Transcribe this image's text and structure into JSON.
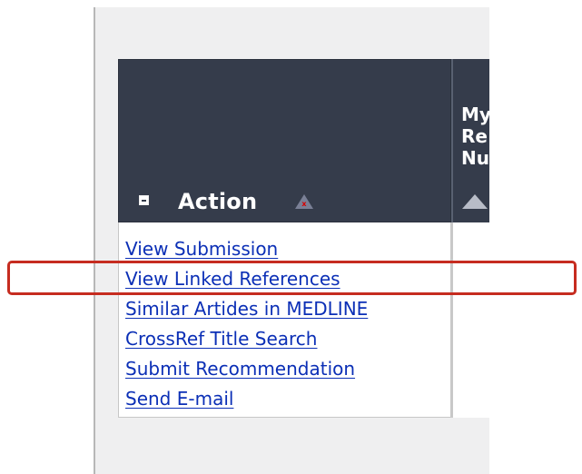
{
  "table": {
    "action_header": "Action",
    "mine_header_lines": [
      "My",
      "Re",
      "Nu"
    ]
  },
  "actions": [
    {
      "label": "View Submission"
    },
    {
      "label": "View Linked References"
    },
    {
      "label": "Similar Artides in MEDLINE"
    },
    {
      "label": "CrossRef Title Search"
    },
    {
      "label": "Submit Recommendation"
    },
    {
      "label": "Send E-mail"
    }
  ],
  "colors": {
    "header_background": "#353c4b",
    "link": "#0b2fb6",
    "highlight": "#c62c20",
    "sort_icon_red": "#d80000"
  },
  "icons": {
    "collapse": "collapse-icon",
    "sort": "sort-up-icon",
    "mine_sort": "sort-up-icon"
  }
}
